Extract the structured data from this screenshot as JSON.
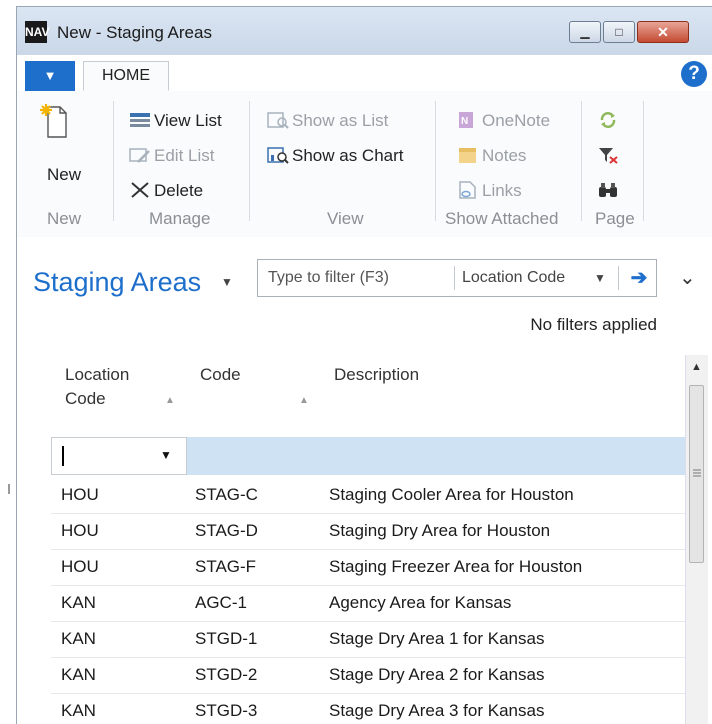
{
  "window": {
    "title": "New - Staging Areas",
    "logo_text": "NAV",
    "min_glyph": "▁",
    "max_glyph": "□",
    "close_glyph": "✕"
  },
  "ribbon": {
    "file_tab_glyph": "▼",
    "home_tab": "HOME",
    "help_glyph": "?",
    "groups": {
      "new": {
        "label": "New",
        "new_button": "New"
      },
      "manage": {
        "label": "Manage",
        "view_list": "View List",
        "edit_list": "Edit List",
        "delete": "Delete"
      },
      "view": {
        "label": "View",
        "show_as_list": "Show as List",
        "show_as_chart": "Show as Chart"
      },
      "show_attached": {
        "label": "Show Attached",
        "onenote": "OneNote",
        "notes": "Notes",
        "links": "Links"
      },
      "page": {
        "label": "Page"
      }
    }
  },
  "page": {
    "title": "Staging Areas",
    "title_caret": "▼",
    "filter": {
      "placeholder": "Type to filter (F3)",
      "field": "Location Code",
      "field_caret": "▼",
      "go_glyph": "➔"
    },
    "collapse_glyph": "⌄",
    "no_filters": "No filters applied"
  },
  "grid": {
    "columns": [
      {
        "line1": "Location",
        "line2": "Code"
      },
      {
        "line1": "Code",
        "line2": ""
      },
      {
        "line1": "Description",
        "line2": ""
      }
    ],
    "sort_glyph": "▲",
    "new_row_caret": "▼",
    "rows": [
      [
        "HOU",
        "STAG-C",
        "Staging Cooler Area for Houston"
      ],
      [
        "HOU",
        "STAG-D",
        "Staging Dry Area for Houston"
      ],
      [
        "HOU",
        "STAG-F",
        "Staging Freezer Area for Houston"
      ],
      [
        "KAN",
        "AGC-1",
        "Agency Area for Kansas"
      ],
      [
        "KAN",
        "STGD-1",
        "Stage Dry Area 1 for Kansas"
      ],
      [
        "KAN",
        "STGD-2",
        "Stage Dry Area 2 for Kansas"
      ],
      [
        "KAN",
        "STGD-3",
        "Stage Dry Area 3 for Kansas"
      ]
    ],
    "scroll_up_glyph": "▲"
  }
}
